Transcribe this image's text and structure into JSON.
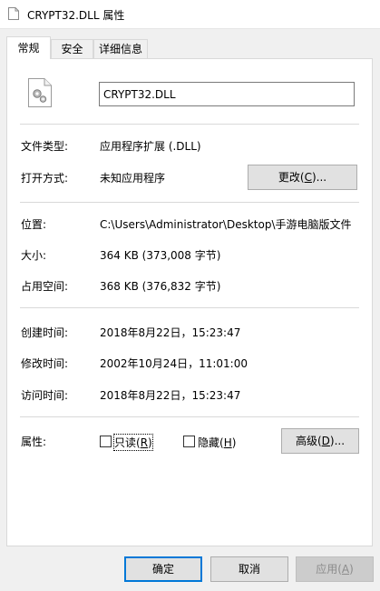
{
  "window": {
    "title": "CRYPT32.DLL 属性"
  },
  "tabs": [
    {
      "label": "常规",
      "active": true
    },
    {
      "label": "安全",
      "active": false
    },
    {
      "label": "详细信息",
      "active": false
    }
  ],
  "general": {
    "filename": "CRYPT32.DLL",
    "file_type": {
      "label": "文件类型:",
      "value": "应用程序扩展 (.DLL)"
    },
    "opens_with": {
      "label": "打开方式:",
      "value": "未知应用程序",
      "button_pre": "更改(",
      "button_key": "C",
      "button_post": ")..."
    },
    "location": {
      "label": "位置:",
      "value": "C:\\Users\\Administrator\\Desktop\\手游电脑版文件"
    },
    "size": {
      "label": "大小:",
      "value": "364 KB (373,008 字节)"
    },
    "size_on_disk": {
      "label": "占用空间:",
      "value": "368 KB (376,832 字节)"
    },
    "created": {
      "label": "创建时间:",
      "value": "2018年8月22日，15:23:47"
    },
    "modified": {
      "label": "修改时间:",
      "value": "2002年10月24日，11:01:00"
    },
    "accessed": {
      "label": "访问时间:",
      "value": "2018年8月22日，15:23:47"
    },
    "attributes": {
      "label": "属性:",
      "readonly": {
        "pre": "只读(",
        "key": "R",
        "post": ")",
        "checked": false
      },
      "hidden": {
        "pre": "隐藏(",
        "key": "H",
        "post": ")",
        "checked": false
      },
      "advanced_pre": "高级(",
      "advanced_key": "D",
      "advanced_post": ")..."
    }
  },
  "buttons": {
    "ok": "确定",
    "cancel": "取消",
    "apply_pre": "应用(",
    "apply_key": "A",
    "apply_post": ")"
  },
  "colors": {
    "focus_border": "#0078d7",
    "panel": "#ffffff",
    "dialog": "#f0f0f0"
  }
}
